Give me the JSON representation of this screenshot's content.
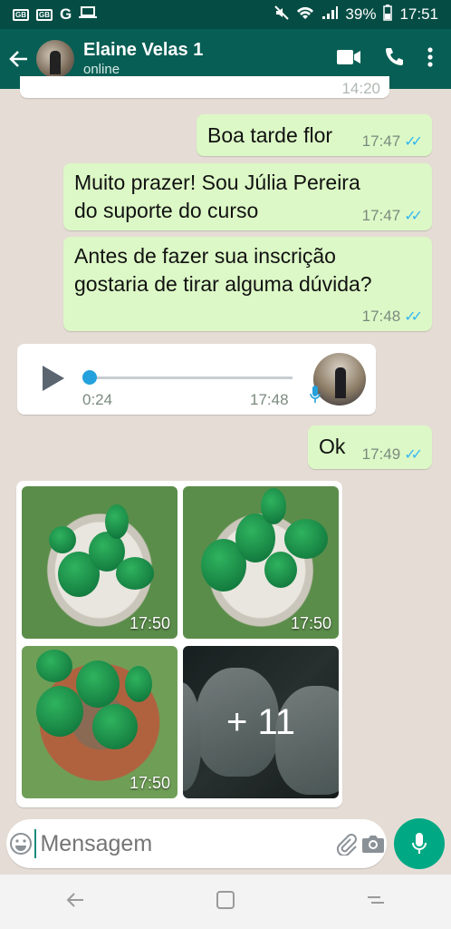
{
  "status_bar": {
    "battery": "39%",
    "time": "17:51"
  },
  "header": {
    "contact_name": "Elaine Velas 1",
    "status": "online"
  },
  "messages": [
    {
      "type": "partial_time",
      "time": "14:20"
    },
    {
      "type": "outgoing",
      "text": "Boa tarde flor",
      "time": "17:47",
      "read": true
    },
    {
      "type": "outgoing",
      "text_lines": [
        "Muito prazer! Sou Júlia Pereira",
        "do suporte do curso"
      ],
      "time": "17:47",
      "read": true
    },
    {
      "type": "outgoing",
      "text_lines": [
        "Antes de fazer sua inscrição",
        "gostaria de tirar alguma dúvida?"
      ],
      "time": "17:48",
      "read": true
    },
    {
      "type": "audio",
      "duration": "0:24",
      "time": "17:48"
    },
    {
      "type": "outgoing",
      "text": "Ok",
      "time": "17:49",
      "read": true
    },
    {
      "type": "image_album",
      "photos": [
        {
          "time": "17:50"
        },
        {
          "time": "17:50"
        },
        {
          "time": "17:50"
        }
      ],
      "more_count": "+ 11"
    }
  ],
  "input": {
    "placeholder": "Mensagem"
  },
  "colors": {
    "header": "#075e54",
    "status_bar": "#054d44",
    "outgoing_bubble": "#dcf8c6",
    "incoming_bubble": "#ffffff",
    "accent": "#00a884",
    "read_ticks": "#34b7f1"
  }
}
